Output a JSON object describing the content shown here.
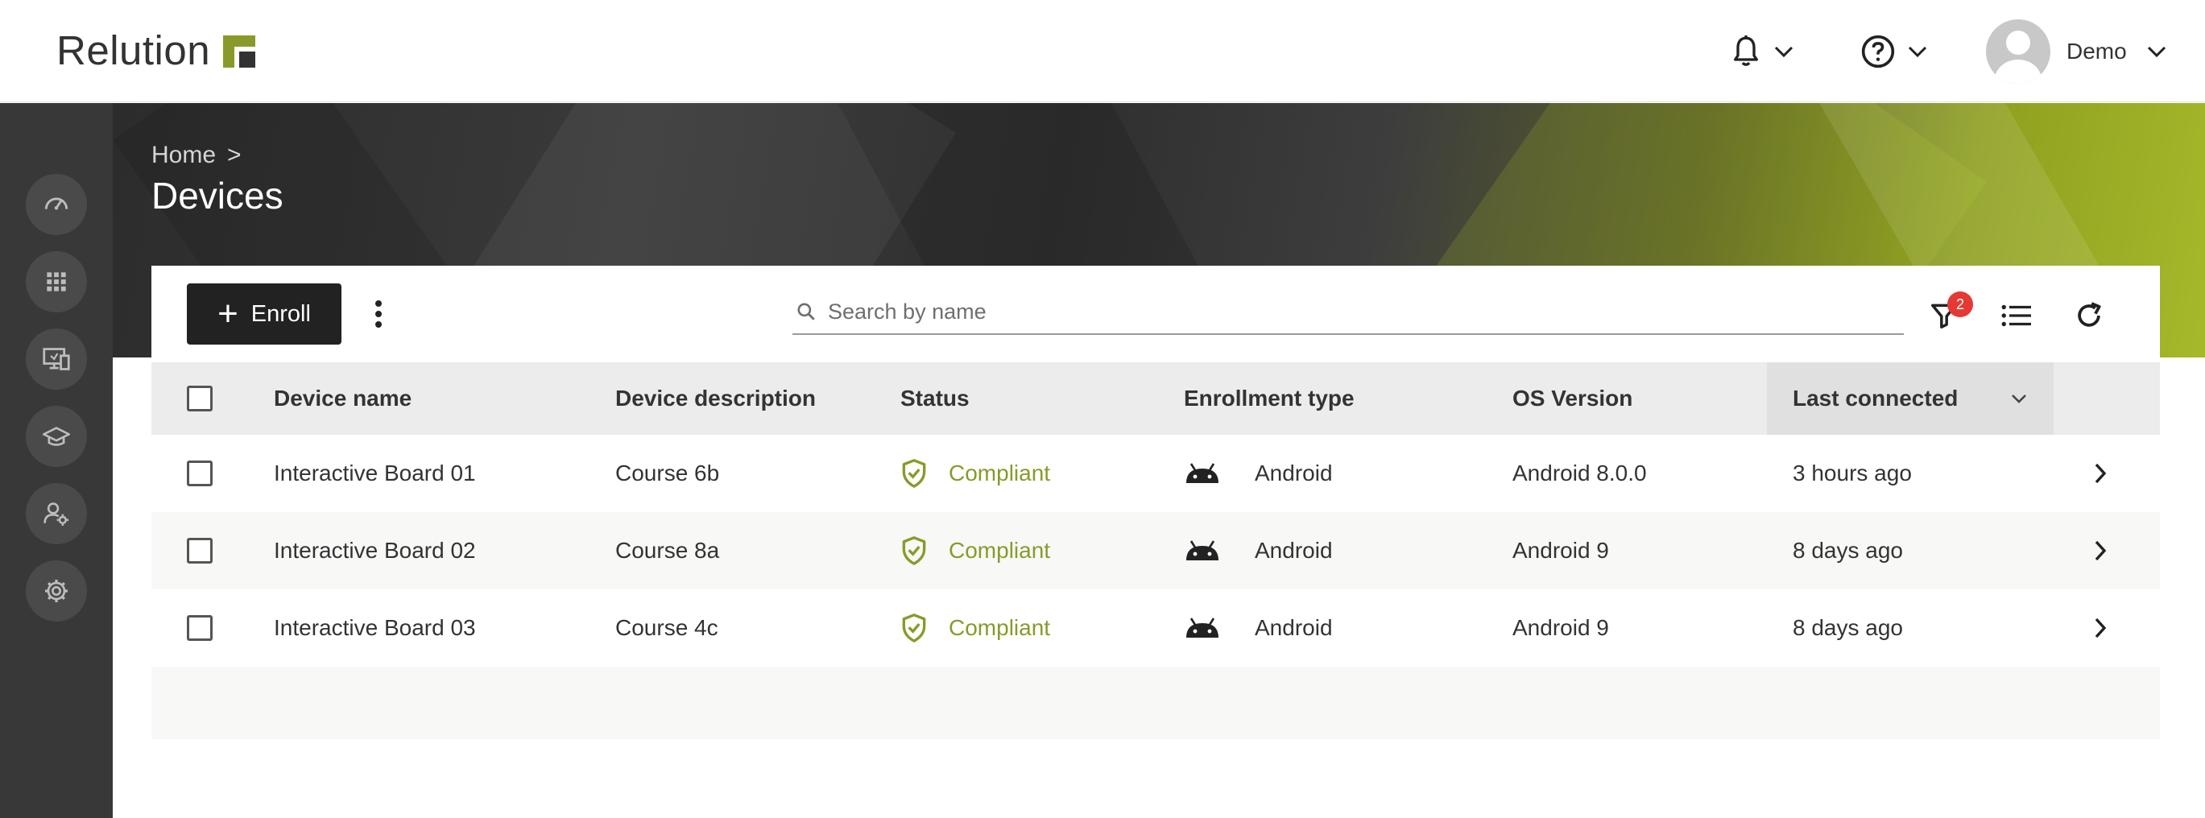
{
  "header": {
    "logo_text": "Relution",
    "user_name": "Demo"
  },
  "breadcrumb": {
    "home": "Home",
    "separator": ">"
  },
  "page_title": "Devices",
  "toolbar": {
    "enroll_label": "Enroll",
    "search_placeholder": "Search by name",
    "filter_count": "2"
  },
  "table": {
    "columns": {
      "device_name": "Device name",
      "device_description": "Device description",
      "status": "Status",
      "enrollment_type": "Enrollment type",
      "os_version": "OS Version",
      "last_connected": "Last connected"
    },
    "rows": [
      {
        "device_name": "Interactive Board 01",
        "description": "Course 6b",
        "status": "Compliant",
        "enrollment_type": "Android",
        "os_version": "Android 8.0.0",
        "last_connected": "3 hours ago"
      },
      {
        "device_name": "Interactive Board 02",
        "description": "Course 8a",
        "status": "Compliant",
        "enrollment_type": "Android",
        "os_version": "Android 9",
        "last_connected": "8 days ago"
      },
      {
        "device_name": "Interactive Board 03",
        "description": "Course 4c",
        "status": "Compliant",
        "enrollment_type": "Android",
        "os_version": "Android 9",
        "last_connected": "8 days ago"
      }
    ]
  },
  "colors": {
    "accent": "#8a9a2a",
    "rail_bg": "#383838",
    "badge": "#e53935"
  },
  "icons": {
    "rail": [
      "dashboard-icon",
      "apps-grid-icon",
      "devices-icon",
      "education-icon",
      "user-settings-icon",
      "settings-icon"
    ],
    "toolbar": [
      "filter-icon",
      "list-view-icon",
      "refresh-icon"
    ]
  }
}
